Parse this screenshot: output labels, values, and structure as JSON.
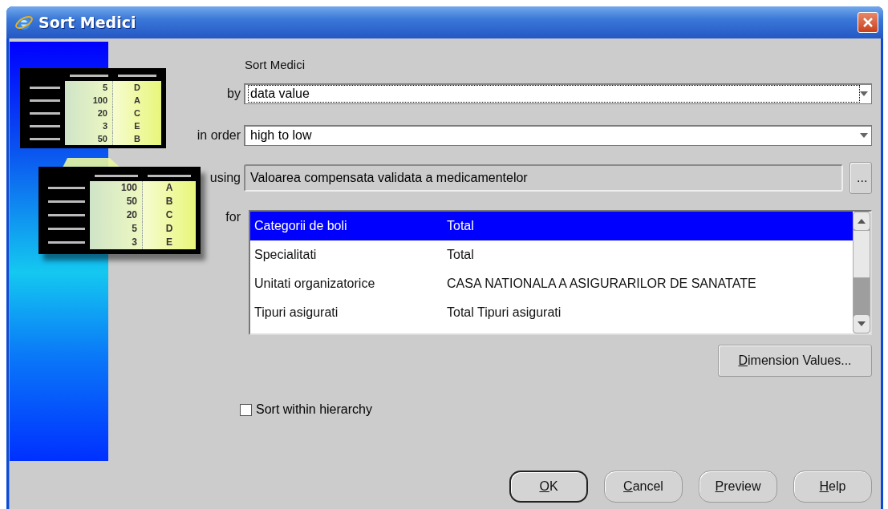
{
  "window": {
    "title": "Sort Medici"
  },
  "illustration": {
    "before": [
      {
        "value": "5",
        "letter": "D"
      },
      {
        "value": "100",
        "letter": "A"
      },
      {
        "value": "20",
        "letter": "C"
      },
      {
        "value": "3",
        "letter": "E"
      },
      {
        "value": "50",
        "letter": "B"
      }
    ],
    "after": [
      {
        "value": "100",
        "letter": "A"
      },
      {
        "value": "50",
        "letter": "B"
      },
      {
        "value": "20",
        "letter": "C"
      },
      {
        "value": "5",
        "letter": "D"
      },
      {
        "value": "3",
        "letter": "E"
      }
    ]
  },
  "heading": "Sort Medici",
  "fields": [
    {
      "kind": "select",
      "label": "by",
      "value": "data value",
      "focused": true
    },
    {
      "kind": "select",
      "label": "in order",
      "value": "high to low",
      "focused": false
    },
    {
      "kind": "text",
      "label": "using",
      "value": "Valoarea compensata validata a medicamentelor",
      "button": "..."
    }
  ],
  "dimensions": {
    "label": "for",
    "rows": [
      {
        "name": "Categorii de boli",
        "value": "Total",
        "selected": true
      },
      {
        "name": "Specialitati",
        "value": "Total",
        "selected": false
      },
      {
        "name": "Unitati organizatorice",
        "value": "CASA NATIONALA A ASIGURARILOR DE SANATATE",
        "selected": false
      },
      {
        "name": "Tipuri asigurati",
        "value": "Total Tipuri asigurati",
        "selected": false
      }
    ],
    "button": "Dimension Values..."
  },
  "sort_within_hierarchy": {
    "label": "Sort within hierarchy",
    "checked": false
  },
  "buttons": [
    {
      "label": "OK",
      "default": true
    },
    {
      "label": "Cancel",
      "default": false
    },
    {
      "label": "Preview",
      "default": false
    },
    {
      "label": "Help",
      "default": false
    }
  ]
}
